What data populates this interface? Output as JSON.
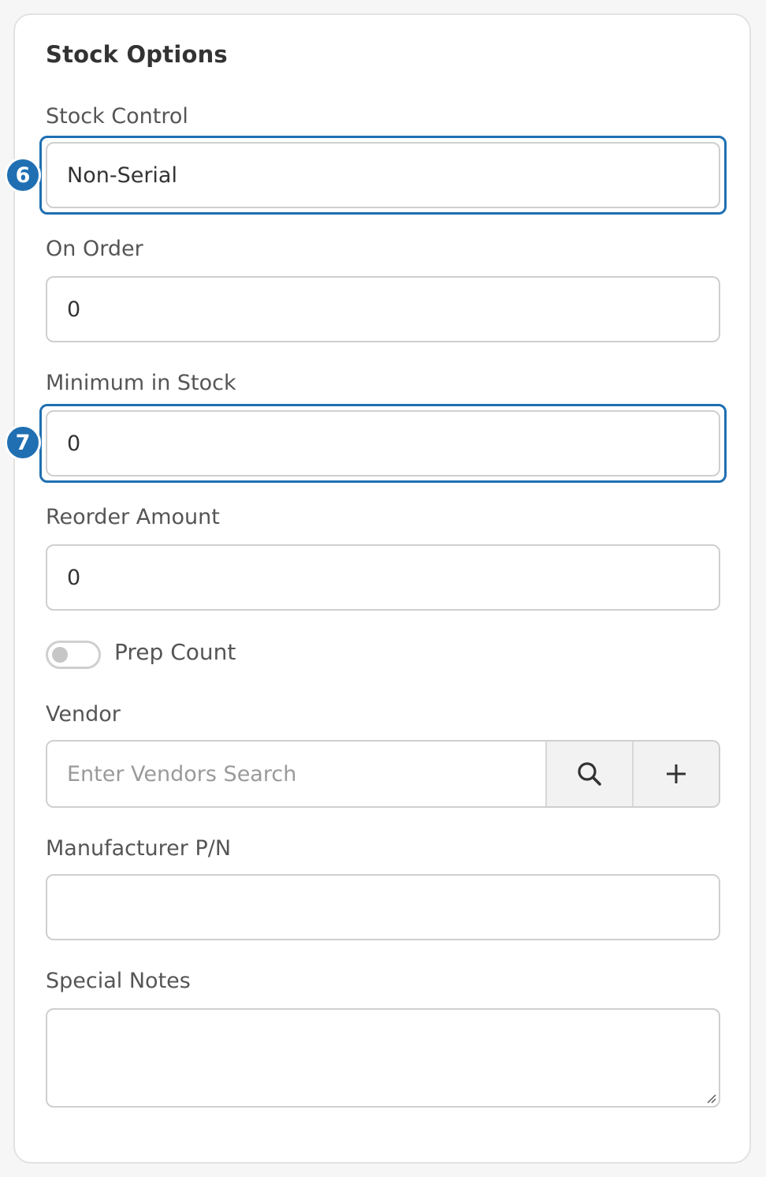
{
  "section": {
    "title": "Stock Options"
  },
  "fields": {
    "stock_control": {
      "label": "Stock Control",
      "value": "Non-Serial",
      "badge": "6"
    },
    "on_order": {
      "label": "On Order",
      "value": "0"
    },
    "minimum_in_stock": {
      "label": "Minimum in Stock",
      "value": "0",
      "badge": "7"
    },
    "reorder_amount": {
      "label": "Reorder Amount",
      "value": "0"
    },
    "prep_count": {
      "label": "Prep Count",
      "checked": false
    },
    "vendor": {
      "label": "Vendor",
      "placeholder": "Enter Vendors Search"
    },
    "manufacturer_pn": {
      "label": "Manufacturer P/N",
      "value": ""
    },
    "special_notes": {
      "label": "Special Notes",
      "value": ""
    }
  },
  "icons": {
    "vendor_search": "search-icon",
    "vendor_add": "plus-icon"
  },
  "colors": {
    "accent": "#1f6fb2",
    "border": "#cfcfcf",
    "label": "#555555"
  }
}
